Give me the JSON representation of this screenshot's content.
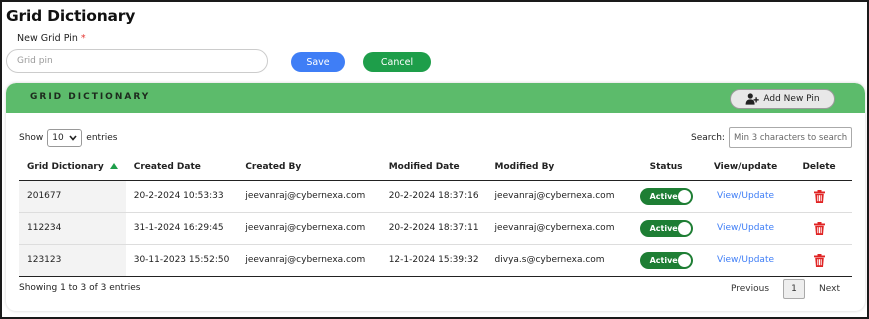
{
  "page": {
    "title": "Grid Dictionary",
    "field_label": "New Grid Pin",
    "required_marker": "*",
    "pin_placeholder": "Grid pin",
    "save_label": "Save",
    "cancel_label": "Cancel"
  },
  "card": {
    "title": "GRID DICTIONARY",
    "add_label": "Add New Pin",
    "add_icon": "add-user-icon"
  },
  "controls": {
    "show_label": "Show",
    "entries_value": "10",
    "entries_label": "entries",
    "search_label": "Search:",
    "search_placeholder": "Min 3 characters to search"
  },
  "table": {
    "columns": [
      "Grid Dictionary",
      "Created Date",
      "Created By",
      "Modified Date",
      "Modified By",
      "Status",
      "View/update",
      "Delete"
    ],
    "rows": [
      {
        "pin": "201677",
        "created_date": "20-2-2024 10:53:33",
        "created_by": "jeevanraj@cybernexa.com",
        "modified_date": "20-2-2024 18:37:16",
        "modified_by": "jeevanraj@cybernexa.com",
        "status": "Active",
        "action": "View/Update"
      },
      {
        "pin": "112234",
        "created_date": "31-1-2024 16:29:45",
        "created_by": "jeevanraj@cybernexa.com",
        "modified_date": "20-2-2024 18:37:11",
        "modified_by": "jeevanraj@cybernexa.com",
        "status": "Active",
        "action": "View/Update"
      },
      {
        "pin": "123123",
        "created_date": "30-11-2023 15:52:50",
        "created_by": "jeevanraj@cybernexa.com",
        "modified_date": "12-1-2024 15:39:32",
        "modified_by": "divya.s@cybernexa.com",
        "status": "Active",
        "action": "View/Update"
      }
    ]
  },
  "footer": {
    "info": "Showing 1 to 3 of 3 entries",
    "previous": "Previous",
    "current_page": "1",
    "next": "Next"
  },
  "colors": {
    "header_green": "#5cbb6b",
    "save_blue": "#3f7ef6",
    "cancel_green": "#1e9e4a",
    "toggle_green": "#1e7e34",
    "delete_red": "#e02424"
  }
}
